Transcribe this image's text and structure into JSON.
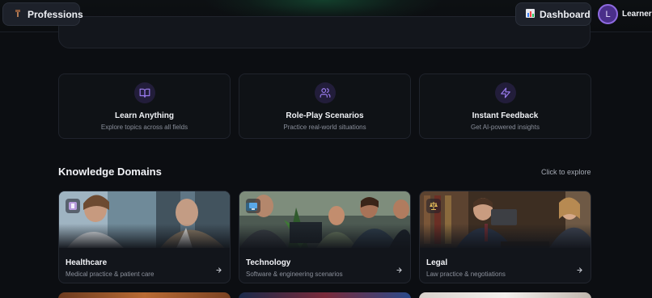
{
  "header": {
    "professions_label": "Professions",
    "dashboard_label": "Dashboard",
    "avatar_initial": "L",
    "username": "Learner"
  },
  "features": [
    {
      "title": "Learn Anything",
      "desc": "Explore topics across all fields",
      "icon": "book-open-icon"
    },
    {
      "title": "Role-Play Scenarios",
      "desc": "Practice real-world situations",
      "icon": "users-icon"
    },
    {
      "title": "Instant Feedback",
      "desc": "Get AI-powered insights",
      "icon": "lightning-icon"
    }
  ],
  "domains_section": {
    "title": "Knowledge Domains",
    "explore_label": "Click to explore"
  },
  "domains": [
    {
      "title": "Healthcare",
      "desc": "Medical practice & patient care",
      "icon": "medical-badge-icon"
    },
    {
      "title": "Technology",
      "desc": "Software & engineering scenarios",
      "icon": "computer-icon"
    },
    {
      "title": "Legal",
      "desc": "Law practice & negotiations",
      "icon": "scales-icon"
    }
  ],
  "colors": {
    "accent": "#8e6ae0",
    "background": "#0c0e12",
    "card": "#12151b"
  }
}
